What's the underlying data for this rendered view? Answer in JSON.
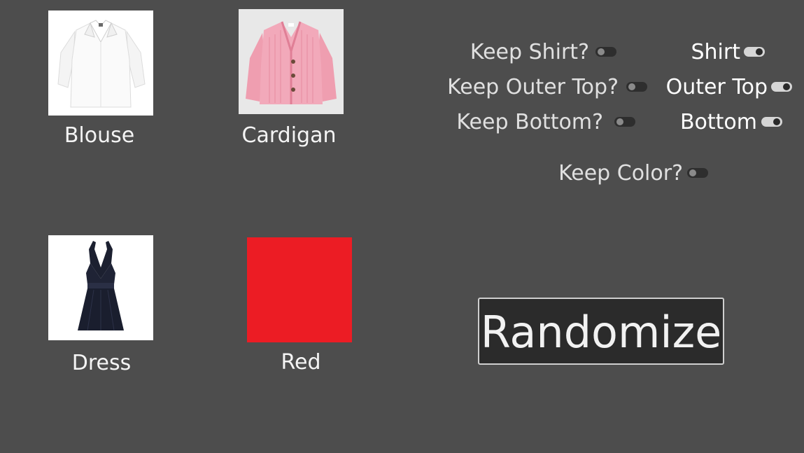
{
  "items": {
    "shirt": {
      "label": "Blouse",
      "icon": "blouse-image"
    },
    "outer_top": {
      "label": "Cardigan",
      "icon": "cardigan-image"
    },
    "bottom": {
      "label": "Dress",
      "icon": "dress-image"
    },
    "color": {
      "label": "Red",
      "swatch": "#ec1c24"
    }
  },
  "options": {
    "keep_shirt": {
      "label": "Keep Shirt?",
      "on": false
    },
    "keep_outer_top": {
      "label": "Keep Outer Top?",
      "on": false
    },
    "keep_bottom": {
      "label": "Keep Bottom?",
      "on": false
    },
    "keep_color": {
      "label": "Keep Color?",
      "on": false
    }
  },
  "categories": {
    "shirt": {
      "label": "Shirt",
      "on": true
    },
    "outer_top": {
      "label": "Outer Top",
      "on": true
    },
    "bottom": {
      "label": "Bottom",
      "on": true
    }
  },
  "actions": {
    "randomize_label": "Randomize"
  },
  "colors": {
    "background": "#4d4d4d",
    "button_bg": "#2b2b2b",
    "swatch_red": "#ec1c24"
  }
}
